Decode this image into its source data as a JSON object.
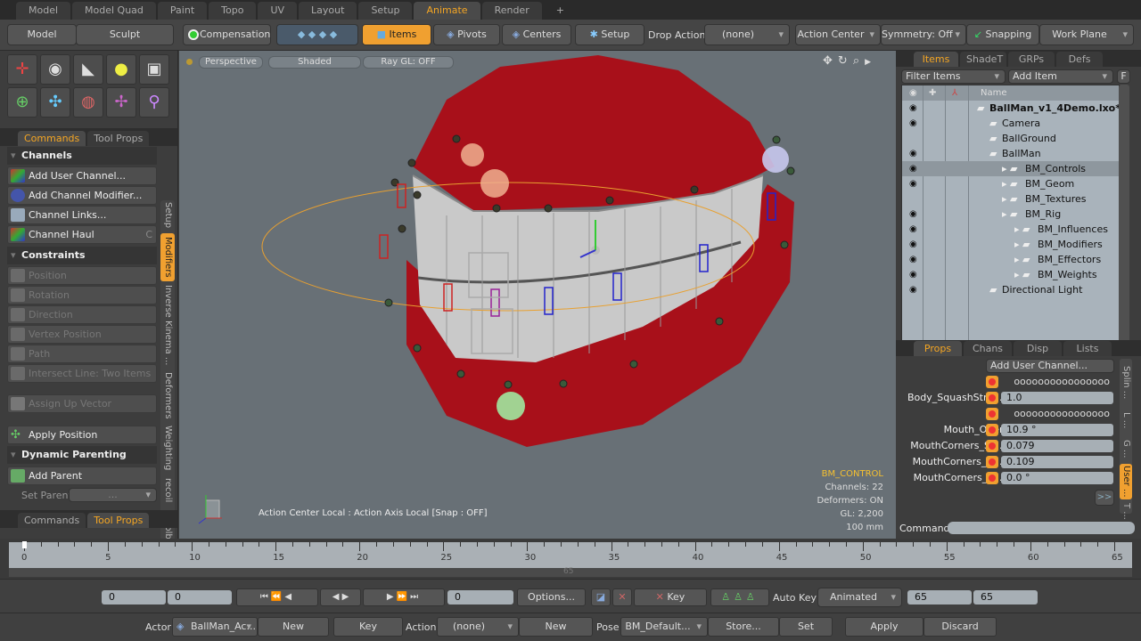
{
  "layout_tabs": [
    "Model",
    "Model Quad",
    "Paint",
    "Topo",
    "UV",
    "Layout",
    "Setup",
    "Animate",
    "Render"
  ],
  "active_layout_tab": "Animate",
  "add_tab": "+",
  "toolbar": {
    "model": "Model",
    "sculpt": "Sculpt",
    "compensation": "Compensation",
    "items": "Items",
    "pivots": "Pivots",
    "centers": "Centers",
    "setup": "Setup",
    "drop_action_label": "Drop Action",
    "drop_action_value": "(none)",
    "action_center": "Action Center",
    "symmetry": "Symmetry: Off",
    "snapping": "Snapping",
    "work_plane": "Work Plane"
  },
  "left_panel": {
    "tabs": [
      "Commands",
      "Tool Props"
    ],
    "channels_header": "Channels",
    "channels": [
      "Add User Channel...",
      "Add Channel Modifier...",
      "Channel Links...",
      "Channel Haul"
    ],
    "channel_haul_shortcut": "C",
    "constraints_header": "Constraints",
    "constraints": [
      "Position",
      "Rotation",
      "Direction",
      "Vertex Position",
      "Path",
      "Intersect Line: Two Items"
    ],
    "assign_up": "Assign Up Vector",
    "apply_position": "Apply Position",
    "dynamic_header": "Dynamic Parenting",
    "add_parent": "Add Parent",
    "set_parent_label": "Set Parent",
    "set_parent_value": "...",
    "vertical_tabs": [
      "Setup",
      "Modifiers",
      "Inverse Kinema ...",
      "Deformers",
      "Weighting",
      "recoil",
      "Toolbox"
    ],
    "bottom_tabs": [
      "Commands",
      "Tool Props"
    ]
  },
  "viewport": {
    "view": "Perspective",
    "shading": "Shaded",
    "raygl": "Ray GL: OFF",
    "status": "Action Center Local : Action Axis Local  [Snap : OFF]",
    "info_title": "BM_CONTROL",
    "info": [
      "Channels: 22",
      "Deformers: ON",
      "GL: 2,200",
      "100 mm"
    ],
    "colors": {
      "mouth": "#b0121a",
      "background": "#687076"
    }
  },
  "items_panel": {
    "tabs": [
      "Items",
      "ShadeT",
      "GRPs",
      "Defs"
    ],
    "filter": "Filter Items",
    "add_item": "Add Item",
    "f_button": "F",
    "name_header": "Name",
    "tree": [
      {
        "label": "BallMan_v1_4Demo.lxo*",
        "indent": 0,
        "eye": true,
        "bold": true
      },
      {
        "label": "Camera",
        "indent": 1,
        "eye": true
      },
      {
        "label": "BallGround",
        "indent": 1,
        "eye": false
      },
      {
        "label": "BallMan",
        "indent": 1,
        "eye": true
      },
      {
        "label": "BM_Controls",
        "indent": 2,
        "eye": true,
        "selected": true
      },
      {
        "label": "BM_Geom",
        "indent": 2,
        "eye": true
      },
      {
        "label": "BM_Textures",
        "indent": 2,
        "eye": false
      },
      {
        "label": "BM_Rig",
        "indent": 2,
        "eye": true
      },
      {
        "label": "BM_Influences",
        "indent": 3,
        "eye": true
      },
      {
        "label": "BM_Modifiers",
        "indent": 3,
        "eye": true
      },
      {
        "label": "BM_Effectors",
        "indent": 3,
        "eye": true
      },
      {
        "label": "BM_Weights",
        "indent": 3,
        "eye": true
      },
      {
        "label": "Directional Light",
        "indent": 1,
        "eye": true
      }
    ]
  },
  "props_panel": {
    "tabs": [
      "Props",
      "Chans",
      "Disp",
      "Lists"
    ],
    "add_user_channel": "Add User Channel...",
    "rows": [
      {
        "label": "",
        "value": "oooooooooooooooo ..."
      },
      {
        "label": "Body_SquashStre ...",
        "value": "1.0"
      },
      {
        "label": "",
        "value": "oooooooooooooooo ..."
      },
      {
        "label": "Mouth_Open",
        "value": "10.9 °"
      },
      {
        "label": "MouthCorners_Sl ...",
        "value": "0.079"
      },
      {
        "label": "MouthCorners_R ...",
        "value": "0.109"
      },
      {
        "label": "MouthCorners_T ...",
        "value": "0.0 °"
      }
    ],
    "vertical_tabs": [
      "Splin ...",
      "L ...",
      "G ...",
      "User ...",
      "T ..."
    ],
    "more": ">>",
    "command_label": "Command"
  },
  "timeline": {
    "start": 0,
    "end": 65,
    "current": 0,
    "labels": [
      0,
      5,
      10,
      15,
      20,
      25,
      30,
      35,
      40,
      45,
      50,
      55,
      60,
      65
    ],
    "end_label": "65"
  },
  "transport": {
    "start_a": "0",
    "start_b": "0",
    "current": "0",
    "options": "Options...",
    "key": "Key",
    "auto_key": "Auto Key",
    "auto_key_mode": "Animated",
    "end_a": "65",
    "end_b": "65"
  },
  "actor_bar": {
    "actor_label": "Actor",
    "actor_value": "BallMan_Ac...",
    "new1": "New",
    "key": "Key",
    "action_label": "Action",
    "action_value": "(none)",
    "new2": "New",
    "pose_label": "Pose",
    "pose_value": "BM_Default...",
    "store": "Store...",
    "set": "Set",
    "apply": "Apply",
    "discard": "Discard"
  }
}
